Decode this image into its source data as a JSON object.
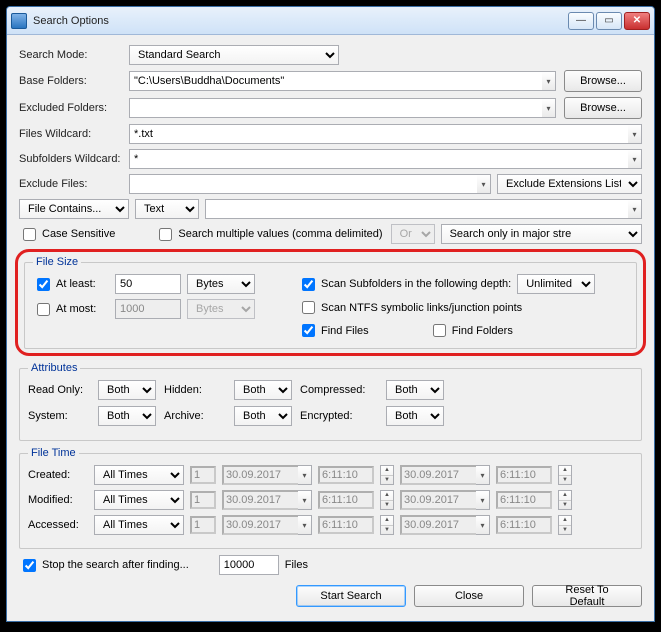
{
  "window": {
    "title": "Search Options"
  },
  "labels": {
    "searchMode": "Search Mode:",
    "baseFolders": "Base Folders:",
    "excludedFolders": "Excluded Folders:",
    "filesWildcard": "Files Wildcard:",
    "subfoldersWildcard": "Subfolders Wildcard:",
    "excludeFiles": "Exclude Files:",
    "browse": "Browse...",
    "excludeExtList": "Exclude Extensions List",
    "fileContains": "File Contains...",
    "text": "Text",
    "caseSensitive": "Case Sensitive",
    "searchMultiple": "Search multiple values (comma delimited)",
    "or": "Or",
    "searchMajor": "Search only in major stre",
    "fileSize": "File Size",
    "atLeast": "At least:",
    "atMost": "At most:",
    "bytes": "Bytes",
    "scanSub": "Scan Subfolders in the following depth:",
    "unlimited": "Unlimited",
    "scanNtfs": "Scan NTFS symbolic links/junction points",
    "findFiles": "Find Files",
    "findFolders": "Find Folders",
    "attributes": "Attributes",
    "readOnly": "Read Only:",
    "hidden": "Hidden:",
    "compressed": "Compressed:",
    "system": "System:",
    "archive": "Archive:",
    "encrypted": "Encrypted:",
    "both": "Both",
    "fileTime": "File Time",
    "created": "Created:",
    "modified": "Modified:",
    "accessed": "Accessed:",
    "allTimes": "All Times",
    "stopAfter": "Stop the search after finding...",
    "files": "Files",
    "startSearch": "Start Search",
    "close": "Close",
    "reset": "Reset To Default"
  },
  "values": {
    "searchMode": "Standard Search",
    "baseFolders": "\"C:\\Users\\Buddha\\Documents\"",
    "excludedFolders": "",
    "filesWildcard": "*.txt",
    "subfoldersWildcard": "*",
    "excludeFiles": "",
    "fileContainsText": "",
    "atLeastChk": true,
    "atLeast": "50",
    "atMostChk": false,
    "atMost": "1000",
    "scanSubChk": true,
    "scanNtfsChk": false,
    "findFilesChk": true,
    "findFoldersChk": false,
    "stopAfterChk": true,
    "stopAfterN": "10000",
    "dateN": "1",
    "date": "30.09.2017",
    "time": "6:11:10"
  }
}
